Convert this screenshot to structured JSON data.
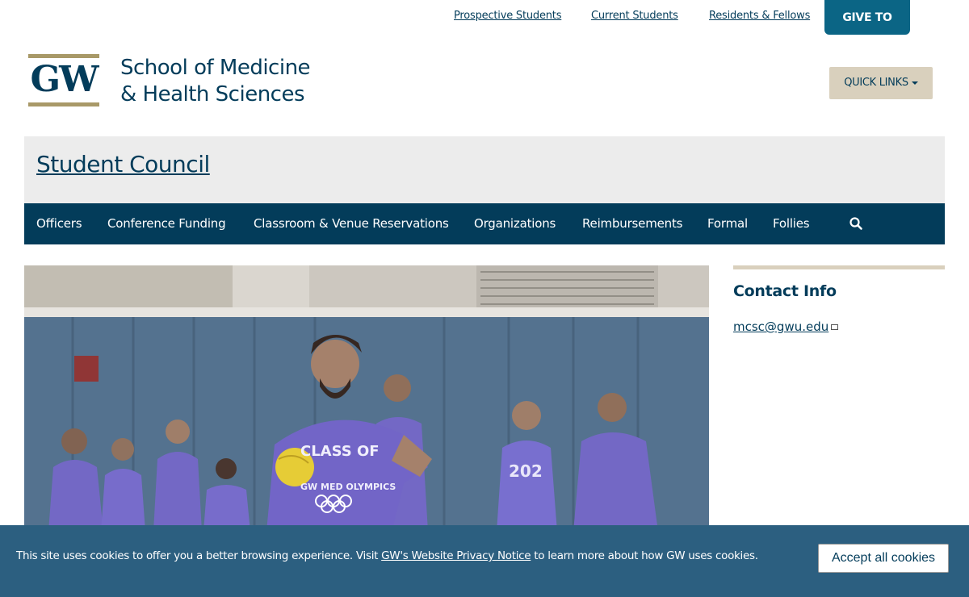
{
  "utility_nav": {
    "links": [
      "Prospective Students",
      "Current Students",
      "Residents & Fellows"
    ],
    "give_label": "GIVE TO SMHS"
  },
  "header": {
    "logo_text": "GW",
    "school_line1": "School of Medicine",
    "school_line2": "& Health Sciences",
    "quick_links_label": "QUICK LINKS"
  },
  "site": {
    "title": "Student Council"
  },
  "main_nav": {
    "items": [
      "Officers",
      "Conference Funding",
      "Classroom & Venue Reservations",
      "Organizations",
      "Reimbursements",
      "Formal",
      "Follies"
    ],
    "search_icon": "search-icon"
  },
  "hero": {
    "shirt_text_1": "CLASS OF",
    "shirt_text_2": "GW MED OLYMPICS",
    "shirt_text_3": "202"
  },
  "sidebar": {
    "title": "Contact Info",
    "email": "mcsc@gwu.edu"
  },
  "cookie": {
    "text_before": "This site uses cookies to offer you a better browsing experience. Visit ",
    "link": "GW's Website Privacy Notice",
    "text_after": " to learn more about how GW uses cookies.",
    "accept_label": "Accept all cookies"
  },
  "colors": {
    "navy": "#033c5a",
    "buff": "#a89968",
    "buff_light": "#d9d0bd",
    "teal": "#0b6585",
    "banner": "#2c5f80"
  }
}
